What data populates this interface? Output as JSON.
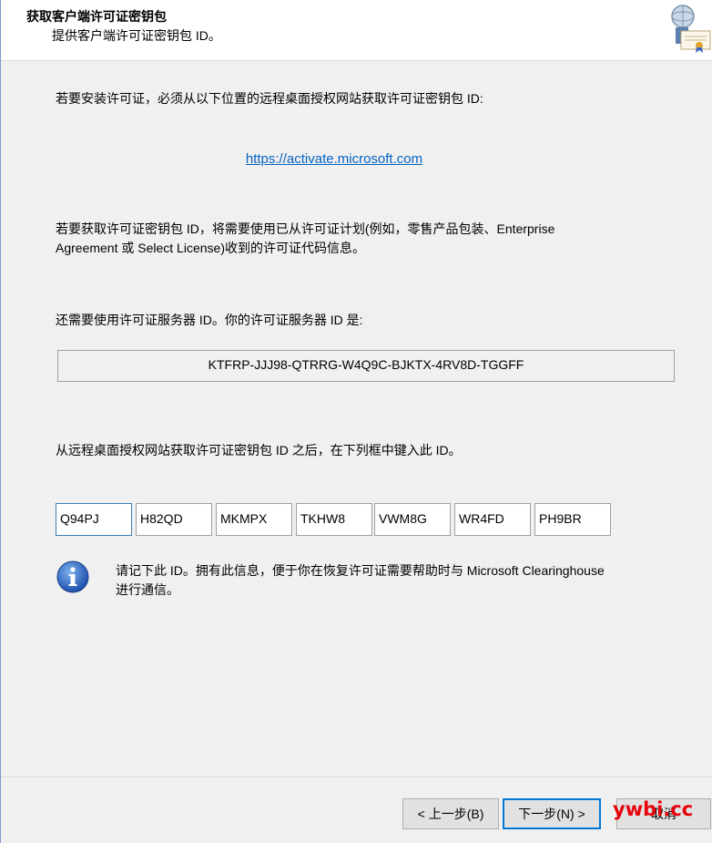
{
  "header": {
    "title": "获取客户端许可证密钥包",
    "subtitle": "提供客户端许可证密钥包 ID。"
  },
  "body": {
    "intro": "若要安装许可证，必须从以下位置的远程桌面授权网站获取许可证密钥包 ID:",
    "link": "https://activate.microsoft.com",
    "agreement_line1": "若要获取许可证密钥包 ID，将需要使用已从许可证计划(例如，零售产品包装、Enterprise",
    "agreement_line2": "Agreement 或 Select License)收到的许可证代码信息。",
    "server_label": "还需要使用许可证服务器 ID。你的许可证服务器 ID 是:",
    "server_id": "KTFRP-JJJ98-QTRRG-W4Q9C-BJKTX-4RV8D-TGGFF",
    "enter_label": "从远程桌面授权网站获取许可证密钥包 ID 之后，在下列框中键入此 ID。",
    "key_parts": [
      "Q94PJ",
      "H82QD",
      "MKMPX",
      "TKHW8",
      "VWM8G",
      "WR4FD",
      "PH9BR"
    ],
    "note_line1": "请记下此 ID。拥有此信息，便于你在恢复许可证需要帮助时与 Microsoft Clearinghouse",
    "note_line2": "进行通信。"
  },
  "footer": {
    "back_label": "< 上一步(B)",
    "next_label": "下一步(N) >",
    "cancel_label": "取消"
  },
  "watermark": "ywbi.cc",
  "icons": {
    "header": "license-certificate-icon",
    "note": "info-icon"
  },
  "colors": {
    "link": "#0563c1",
    "focus": "#0078d7",
    "watermark": "#e8000b"
  }
}
